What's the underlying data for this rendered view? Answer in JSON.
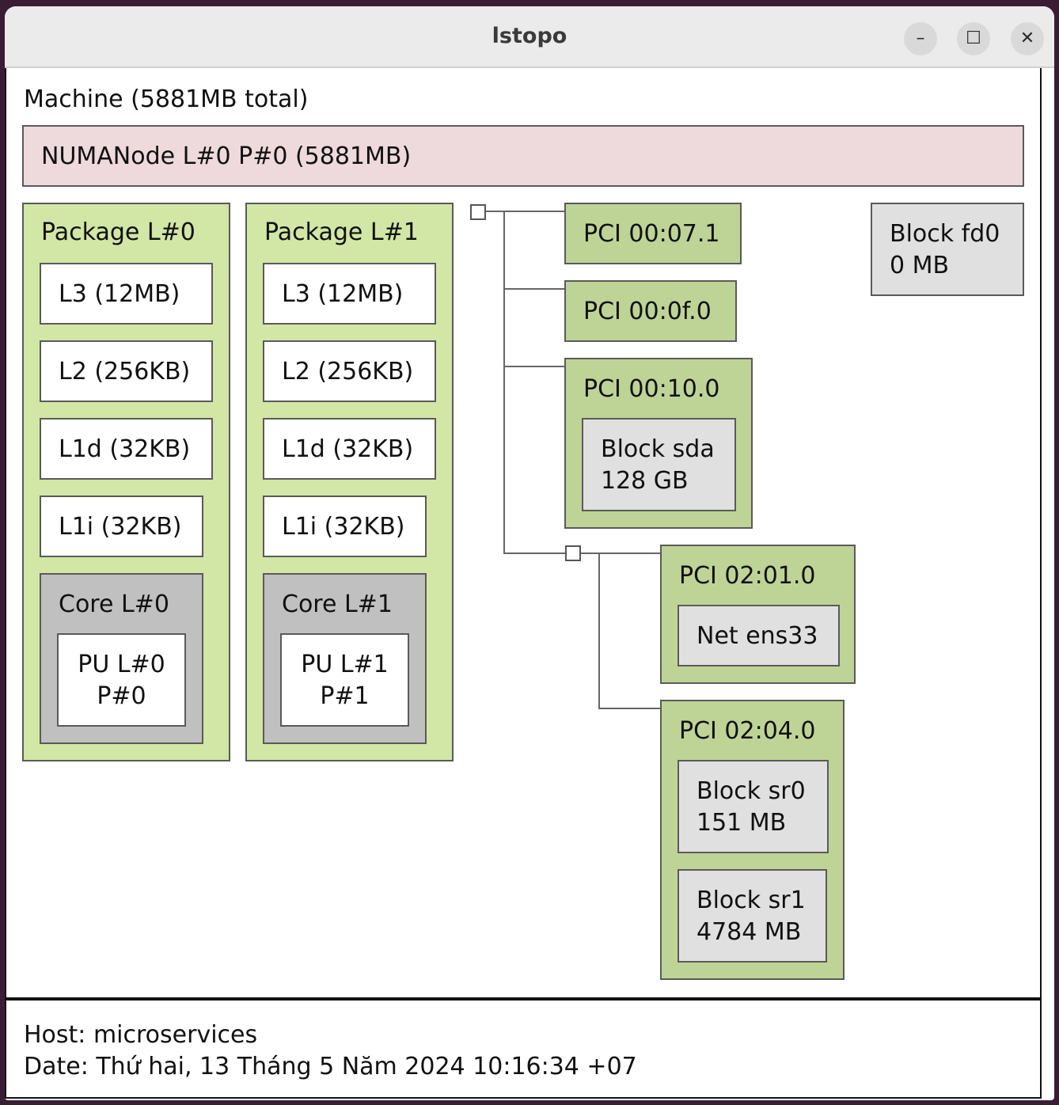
{
  "window": {
    "title": "lstopo",
    "buttons": [
      "–",
      "☐",
      "✕"
    ]
  },
  "machine": {
    "label": "Machine (5881MB total)",
    "numa": "NUMANode L#0 P#0 (5881MB)",
    "packages": [
      {
        "label": "Package L#0",
        "caches": [
          "L3 (12MB)",
          "L2 (256KB)",
          "L1d (32KB)",
          "L1i (32KB)"
        ],
        "core": "Core L#0",
        "pu": "PU L#0\nP#0"
      },
      {
        "label": "Package L#1",
        "caches": [
          "L3 (12MB)",
          "L2 (256KB)",
          "L1d (32KB)",
          "L1i (32KB)"
        ],
        "core": "Core L#1",
        "pu": "PU L#1\nP#1"
      }
    ],
    "pci": {
      "p00071": "PCI 00:07.1",
      "p000f0": "PCI 00:0f.0",
      "p00100": "PCI 00:10.0",
      "block_sda": "Block sda\n128 GB",
      "p02010": "PCI 02:01.0",
      "net_ens33": "Net ens33",
      "p02040": "PCI 02:04.0",
      "block_sr0": "Block sr0\n151 MB",
      "block_sr1": "Block sr1\n4784 MB"
    },
    "block_fd0": "Block fd0\n0 MB"
  },
  "footer": {
    "host": "Host: microservices",
    "date": "Date: Thứ hai, 13 Tháng 5 Năm 2024 10:16:34 +07"
  }
}
